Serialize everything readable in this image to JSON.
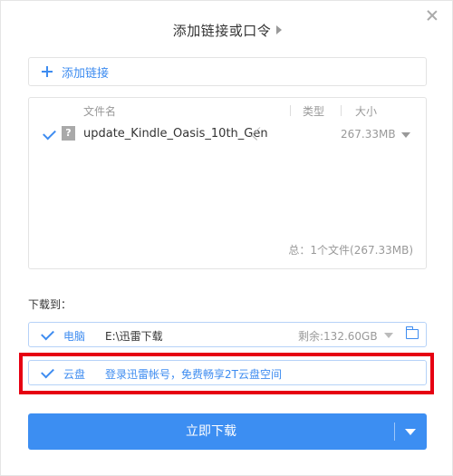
{
  "dialog": {
    "title": "添加链接或口令",
    "icons": {
      "close": "close-icon",
      "title_arrow": "triangle-right-icon"
    }
  },
  "add_link": {
    "label": "添加链接",
    "icon": "plus-icon"
  },
  "file_list": {
    "columns": {
      "name": "文件名",
      "type": "类型",
      "size": "大小"
    },
    "files": [
      {
        "checked": true,
        "icon": "unknown-file-icon",
        "icon_glyph": "?",
        "name": "update_Kindle_Oasis_10th_Gen",
        "size": "267.33MB"
      }
    ],
    "summary": "总：1个文件(267.33MB)"
  },
  "download_to": {
    "label": "下载到：",
    "pc": {
      "checked": true,
      "type": "电脑",
      "path": "E:\\迅雷下载",
      "free": "剩余:132.60GB"
    },
    "cloud": {
      "checked": true,
      "type": "云盘",
      "text": "登录迅雷帐号，免费畅享2T云盘空间"
    }
  },
  "download_button": {
    "label": "立即下载"
  },
  "colors": {
    "accent": "#3e8cf0",
    "button": "#3c8ef2",
    "highlight": "#e60012"
  }
}
